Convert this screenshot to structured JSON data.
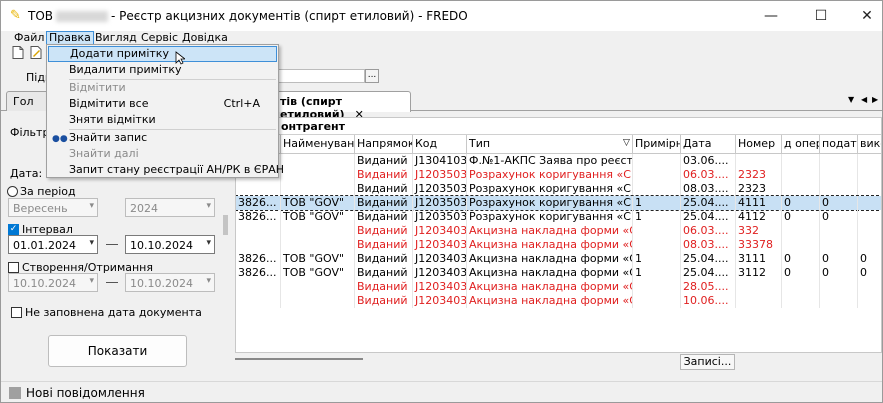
{
  "window": {
    "title_prefix": "ТОВ",
    "title_suffix": "- Реєстр акцизних документів (спирт етиловий) - FREDO",
    "minimize": "—",
    "maximize": "☐",
    "close": "✕"
  },
  "menubar": [
    "Файл",
    "Правка",
    "Вигляд",
    "Сервіс",
    "Довідка"
  ],
  "edit_menu": {
    "add_note": "Додати примітку",
    "delete_note": "Видалити примітку",
    "mark_header": "Відмітити",
    "mark_all": "Відмітити все",
    "mark_all_shortcut": "Ctrl+A",
    "unmark": "Зняти відмітки",
    "find": "Знайти запис",
    "find_next": "Знайти далі",
    "query_status": "Запит стану реєстрації АН/РК в ЄРАН"
  },
  "toolbar": {
    "pidp_label": "Підп",
    "dots": "..."
  },
  "tabs": [
    {
      "label": "Гол"
    },
    {
      "label": "тів (спирт етиловий)",
      "close": "✕"
    }
  ],
  "tab_controls": {
    "down": "▼",
    "left": "◀",
    "right": "▶"
  },
  "filter": {
    "title": "Фільтр",
    "date_label": "Дата:",
    "period_label": "За період",
    "month": "Вересень",
    "year": "2024",
    "interval_label": "Інтервал",
    "interval_checked": true,
    "date_from": "01.01.2024",
    "date_to": "10.10.2024",
    "created_label": "Створення/Отримання",
    "created_from": "10.10.2024",
    "created_to": "10.10.2024",
    "no_date_label": "Не заповнена дата документа",
    "show_button": "Показати"
  },
  "grid": {
    "group_header": "онтрагент",
    "columns": [
      "",
      "Найменування",
      "Напрямок",
      "Код",
      "Тип",
      "Примірник",
      "Дата",
      "Номер",
      "д опера",
      "податк",
      "вико"
    ],
    "rows": [
      {
        "c0": "",
        "name": "",
        "dir": "Виданий",
        "code": "J1304103",
        "type": "Ф.№1-АКПС Заява про реєст...",
        "copy": "",
        "date": "03.06....",
        "num": "",
        "op": "",
        "tax": "",
        "vik": "",
        "red": false,
        "selected": false
      },
      {
        "c0": "",
        "name": "",
        "dir": "Виданий",
        "code": "J1203503",
        "type": "Розрахунок коригування «С»",
        "copy": "",
        "date": "06.03....",
        "num": "2323",
        "op": "",
        "tax": "",
        "vik": "",
        "red": true,
        "selected": false
      },
      {
        "c0": "",
        "name": "",
        "dir": "Виданий",
        "code": "J1203503",
        "type": "Розрахунок коригування «С»",
        "copy": "",
        "date": "08.03....",
        "num": "2323",
        "op": "",
        "tax": "",
        "vik": "",
        "red": false,
        "selected": false
      },
      {
        "c0": "3826...",
        "name": "ТОВ \"GOV\"",
        "dir": "Виданий",
        "code": "J1203503",
        "type": "Розрахунок коригування «С»",
        "copy": "1",
        "date": "25.04....",
        "num": "4111",
        "op": "0",
        "tax": "0",
        "vik": "",
        "red": false,
        "selected": true
      },
      {
        "c0": "3826...",
        "name": "ТОВ \"GOV\"",
        "dir": "Виданий",
        "code": "J1203503",
        "type": "Розрахунок коригування «С»",
        "copy": "1",
        "date": "25.04....",
        "num": "4112",
        "op": "0",
        "tax": "0",
        "vik": "",
        "red": false,
        "selected": false
      },
      {
        "c0": "",
        "name": "",
        "dir": "Виданий",
        "code": "J1203403",
        "type": "Акцизна накладна форми «С»",
        "copy": "",
        "date": "06.03....",
        "num": "332",
        "op": "",
        "tax": "",
        "vik": "",
        "red": true,
        "selected": false
      },
      {
        "c0": "",
        "name": "",
        "dir": "Виданий",
        "code": "J1203403",
        "type": "Акцизна накладна форми «С»",
        "copy": "",
        "date": "08.03....",
        "num": "33378",
        "op": "",
        "tax": "",
        "vik": "",
        "red": true,
        "selected": false
      },
      {
        "c0": "3826...",
        "name": "ТОВ \"GOV\"",
        "dir": "Виданий",
        "code": "J1203403",
        "type": "Акцизна накладна форми «С»",
        "copy": "1",
        "date": "25.04....",
        "num": "3111",
        "op": "0",
        "tax": "0",
        "vik": "0",
        "red": false,
        "selected": false
      },
      {
        "c0": "3826...",
        "name": "ТОВ \"GOV\"",
        "dir": "Виданий",
        "code": "J1203403",
        "type": "Акцизна накладна форми «С»",
        "copy": "1",
        "date": "25.04....",
        "num": "3112",
        "op": "0",
        "tax": "0",
        "vik": "0",
        "red": false,
        "selected": false
      },
      {
        "c0": "",
        "name": "",
        "dir": "Виданий",
        "code": "J1203403",
        "type": "Акцизна накладна форми «С»",
        "copy": "",
        "date": "28.05....",
        "num": "",
        "op": "",
        "tax": "",
        "vik": "",
        "red": true,
        "selected": false
      },
      {
        "c0": "",
        "name": "",
        "dir": "Виданий",
        "code": "J1203403",
        "type": "Акцизна накладна форми «С»",
        "copy": "",
        "date": "10.06....",
        "num": "",
        "op": "",
        "tax": "",
        "vik": "",
        "red": true,
        "selected": false
      }
    ],
    "records_button": "Записі..."
  },
  "status": {
    "new_messages": "Нові повідомлення"
  }
}
